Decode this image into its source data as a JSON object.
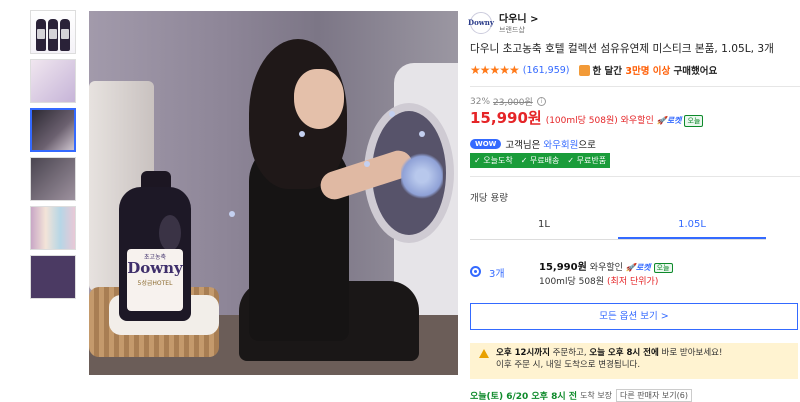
{
  "thumbnails": [
    {
      "name": "thumb-bottles"
    },
    {
      "name": "thumb-flowers"
    },
    {
      "name": "thumb-model",
      "active": true
    },
    {
      "name": "thumb-washer"
    },
    {
      "name": "thumb-lineup"
    },
    {
      "name": "thumb-banner"
    }
  ],
  "main_image": {
    "bottle_label_kr": "초고농축",
    "bottle_brand": "Downy",
    "bottle_sub": "5성급HOTEL"
  },
  "brand": {
    "logo_text": "Downy",
    "name": "다우니",
    "chevron": ">",
    "sub": "브랜드샵"
  },
  "product": {
    "title": "다우니 초고농축 호텔 컬렉션 섬유유연제 미스티크 본품, 1.05L, 3개"
  },
  "rating": {
    "stars": "★★★★★",
    "review_count": "(161,959)",
    "buy_prefix": "한 달간",
    "buy_highlight": "3만명 이상",
    "buy_suffix": "구매했어요"
  },
  "price": {
    "discount_pct": "32%",
    "original": "23,000원",
    "info": "i",
    "current": "15,990원",
    "unit": "(100ml당 508원) 와우할인",
    "rocket": "🚀로켓",
    "today": "오늘"
  },
  "wow": {
    "badge": "WOW",
    "text_prefix": "고객님은",
    "link": "와우회원",
    "text_suffix": "으로",
    "benefits": [
      "✓ 오늘도착",
      "✓ 무료배송",
      "✓ 무료반품"
    ]
  },
  "options": {
    "label": "개당 용량",
    "tabs": [
      "1L",
      "1.05L"
    ],
    "active_tab": 1,
    "selected": {
      "qty": "3개",
      "price": "15,990원",
      "discount": "와우할인",
      "rocket": "🚀로켓",
      "today": "오늘",
      "unit": "100ml당 508원",
      "lowest": "(최저 단위가)"
    },
    "all_button": "모든 옵션 보기 >"
  },
  "notice": {
    "line1_bold": "오후 12시까지",
    "line1_mid": "주문하고,",
    "line1_bold2": "오늘 오후 8시 전에",
    "line1_end": "바로 받아보세요!",
    "line2": "이후 주문 시, 내일 도착으로 변경됩니다."
  },
  "arrival": {
    "text": "오늘(토) 6/20 오후 8시 전",
    "small": "도착 보장",
    "other_seller": "다른 판매자 보기(6)"
  },
  "colors": {
    "accent": "#346aff",
    "price_red": "#e52528",
    "star_orange": "#ff7a1a",
    "green": "#1a9c3a"
  }
}
